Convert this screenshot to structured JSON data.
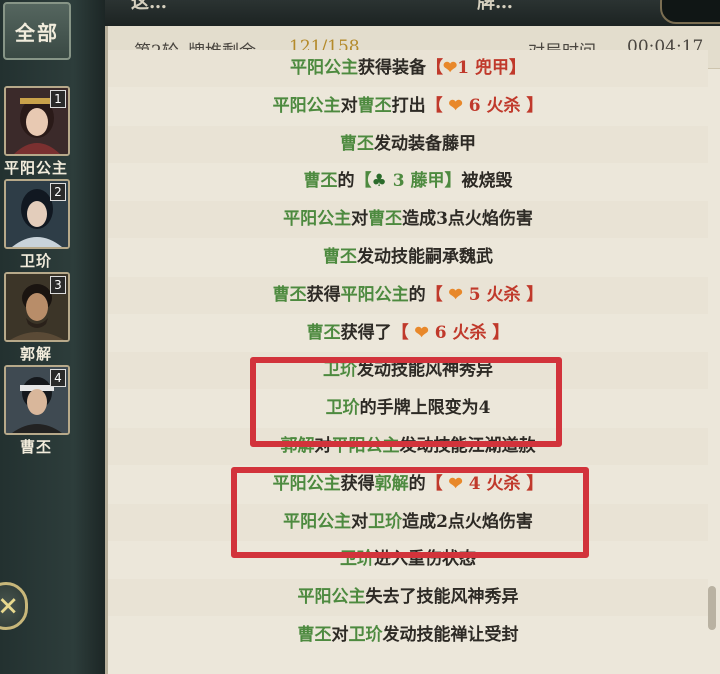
{
  "top": {
    "title_fragment": "这…",
    "count_fragment": "牌…"
  },
  "sidebar": {
    "all_label": "全部",
    "players": [
      {
        "seat": "1",
        "name": "平阳公主"
      },
      {
        "seat": "2",
        "name": "卫玠"
      },
      {
        "seat": "3",
        "name": "郭解"
      },
      {
        "seat": "4",
        "name": "曹丕"
      }
    ],
    "close_icon": "×"
  },
  "header": {
    "round": "第2轮",
    "deck_label": "牌堆剩余",
    "deck_value": "121/158",
    "time_label": "对局时间",
    "time_value": "00:04:17"
  },
  "log": [
    {
      "parts": [
        {
          "t": "平阳公主",
          "c": "g"
        },
        {
          "t": "获得装备"
        },
        {
          "t": "【",
          "c": "r"
        },
        {
          "t": "❤",
          "c": "heart"
        },
        {
          "t": "1 兜甲",
          "c": "r"
        },
        {
          "t": "】",
          "c": "r"
        }
      ]
    },
    {
      "parts": [
        {
          "t": "平阳公主",
          "c": "g"
        },
        {
          "t": "对"
        },
        {
          "t": "曹丕",
          "c": "g"
        },
        {
          "t": "打出"
        },
        {
          "t": "【 ",
          "c": "r"
        },
        {
          "t": "❤",
          "c": "heart"
        },
        {
          "t": " 6 火杀 ",
          "c": "r"
        },
        {
          "t": "】",
          "c": "r"
        }
      ]
    },
    {
      "parts": [
        {
          "t": "曹丕",
          "c": "g"
        },
        {
          "t": "发动装备藤甲"
        }
      ]
    },
    {
      "parts": [
        {
          "t": "曹丕",
          "c": "g"
        },
        {
          "t": "的"
        },
        {
          "t": "【",
          "c": "g"
        },
        {
          "t": "♣",
          "c": "club"
        },
        {
          "t": " 3 藤甲",
          "c": "g"
        },
        {
          "t": "】",
          "c": "g"
        },
        {
          "t": "被烧毁"
        }
      ]
    },
    {
      "parts": [
        {
          "t": "平阳公主",
          "c": "g"
        },
        {
          "t": "对"
        },
        {
          "t": "曹丕",
          "c": "g"
        },
        {
          "t": "造成3点火焰伤害"
        }
      ]
    },
    {
      "parts": [
        {
          "t": "曹丕",
          "c": "g"
        },
        {
          "t": "发动技能嗣承魏武"
        }
      ]
    },
    {
      "parts": [
        {
          "t": "曹丕",
          "c": "g"
        },
        {
          "t": "获得"
        },
        {
          "t": "平阳公主",
          "c": "g"
        },
        {
          "t": "的"
        },
        {
          "t": "【 ",
          "c": "r"
        },
        {
          "t": "❤",
          "c": "heart"
        },
        {
          "t": " 5 火杀 ",
          "c": "r"
        },
        {
          "t": "】",
          "c": "r"
        }
      ]
    },
    {
      "parts": [
        {
          "t": "曹丕",
          "c": "g"
        },
        {
          "t": "获得了"
        },
        {
          "t": "【 ",
          "c": "r"
        },
        {
          "t": "❤",
          "c": "heart"
        },
        {
          "t": " 6 火杀 ",
          "c": "r"
        },
        {
          "t": "】",
          "c": "r"
        }
      ]
    },
    {
      "parts": [
        {
          "t": "卫玠",
          "c": "g"
        },
        {
          "t": "发动技能风神秀异"
        }
      ]
    },
    {
      "parts": [
        {
          "t": "卫玠",
          "c": "g"
        },
        {
          "t": "的手牌上限变为4"
        }
      ]
    },
    {
      "parts": [
        {
          "t": "郭解",
          "c": "g"
        },
        {
          "t": "对"
        },
        {
          "t": "平阳公主",
          "c": "g"
        },
        {
          "t": "发动技能江湖道赦"
        }
      ]
    },
    {
      "parts": [
        {
          "t": "平阳公主",
          "c": "g"
        },
        {
          "t": "获得"
        },
        {
          "t": "郭解",
          "c": "g"
        },
        {
          "t": "的"
        },
        {
          "t": "【 ",
          "c": "r"
        },
        {
          "t": "❤",
          "c": "heart"
        },
        {
          "t": " 4 火杀 ",
          "c": "r"
        },
        {
          "t": "】",
          "c": "r"
        }
      ]
    },
    {
      "parts": [
        {
          "t": "平阳公主",
          "c": "g"
        },
        {
          "t": "对"
        },
        {
          "t": "卫玠",
          "c": "g"
        },
        {
          "t": "造成2点火焰伤害"
        }
      ]
    },
    {
      "parts": [
        {
          "t": "卫玠",
          "c": "g"
        },
        {
          "t": "进入重伤状态"
        }
      ]
    },
    {
      "parts": [
        {
          "t": "平阳公主",
          "c": "g"
        },
        {
          "t": "失去了技能风神秀异"
        }
      ]
    },
    {
      "parts": [
        {
          "t": "曹丕",
          "c": "g"
        },
        {
          "t": "对"
        },
        {
          "t": "卫玠",
          "c": "g"
        },
        {
          "t": "发动技能禅让受封"
        }
      ]
    }
  ]
}
